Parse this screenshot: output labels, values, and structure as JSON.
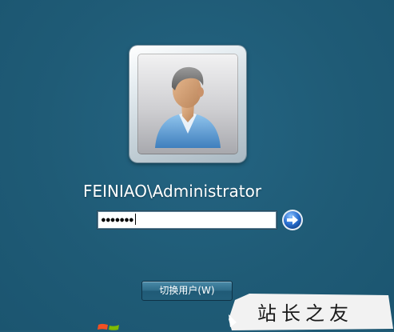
{
  "login": {
    "username": "FEINIAO\\Administrator",
    "password_masked": "●●●●●●●",
    "switch_user_label": "切换用户(W)"
  },
  "icons": {
    "avatar": "user-avatar-icon",
    "submit": "arrow-right-icon",
    "logo": "windows-logo-icon"
  },
  "colors": {
    "background": "#215c77",
    "arrow_button": "#2a6fd0"
  },
  "watermark": {
    "text": "站长之友"
  }
}
